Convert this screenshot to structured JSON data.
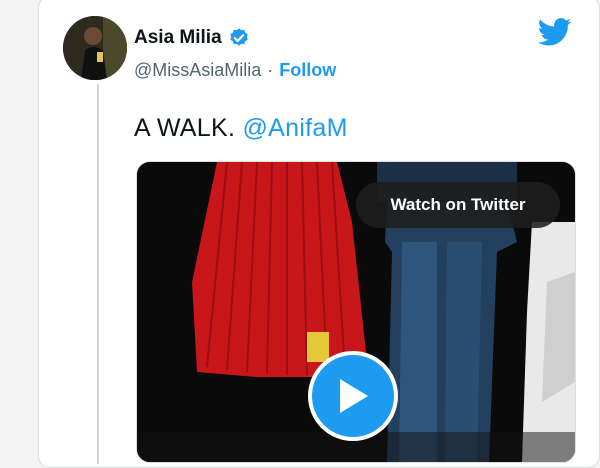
{
  "author": {
    "display_name": "Asia Milia",
    "handle": "@MissAsiaMilia",
    "separator": "·",
    "follow_label": "Follow",
    "verified": true
  },
  "tweet": {
    "text": "A WALK.",
    "mention": "@AnifaM"
  },
  "media": {
    "watch_label": "Watch on Twitter",
    "play_icon": "play-icon"
  },
  "colors": {
    "accent": "#1d9bf0",
    "text": "#0f1419",
    "muted": "#536471"
  },
  "icons": [
    "verified-badge-icon",
    "twitter-bird-icon",
    "play-icon"
  ]
}
